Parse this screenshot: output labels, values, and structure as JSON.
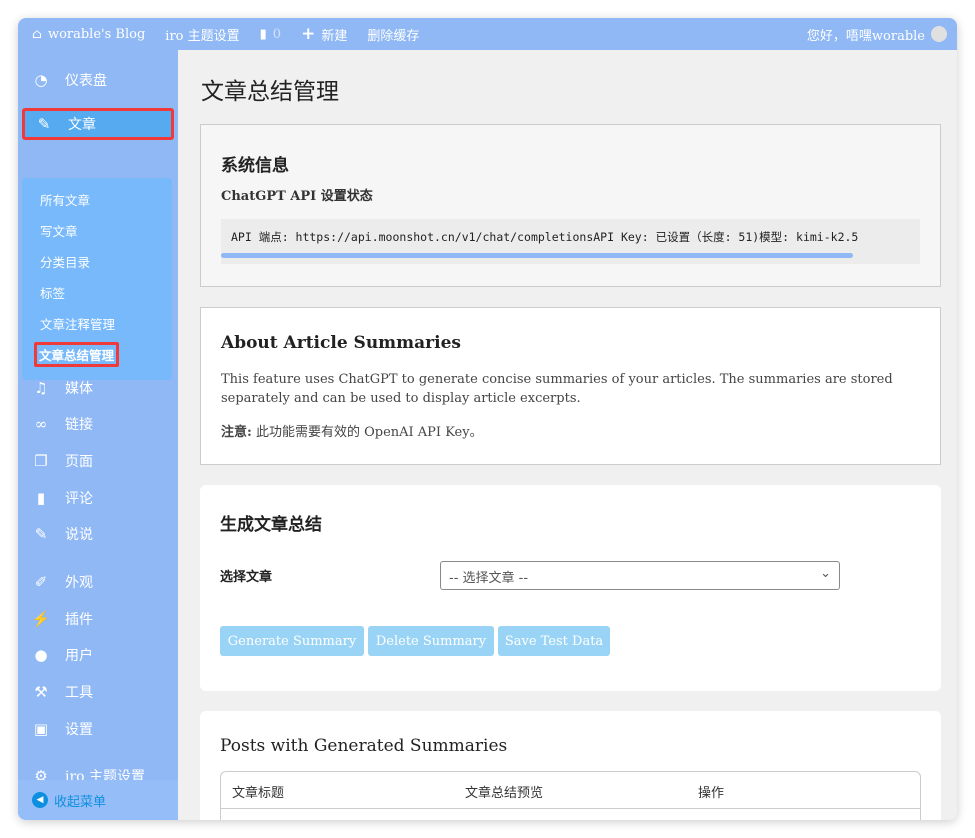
{
  "topbar": {
    "site": "worable's Blog",
    "theme": "iro 主题设置",
    "comments": "0",
    "new": "新建",
    "cache": "删除缓存",
    "greeting": "您好，唔嘿worable"
  },
  "sidebar": {
    "items": [
      {
        "label": "仪表盘",
        "icon": "dashboard-icon"
      },
      {
        "label": "文章",
        "icon": "pin-icon"
      },
      {
        "label": "媒体",
        "icon": "media-icon"
      },
      {
        "label": "链接",
        "icon": "link-icon"
      },
      {
        "label": "页面",
        "icon": "pages-icon"
      },
      {
        "label": "评论",
        "icon": "comment-icon"
      },
      {
        "label": "说说",
        "icon": "pin-icon"
      },
      {
        "label": "外观",
        "icon": "brush-icon"
      },
      {
        "label": "插件",
        "icon": "plugin-icon"
      },
      {
        "label": "用户",
        "icon": "user-icon"
      },
      {
        "label": "工具",
        "icon": "wrench-icon"
      },
      {
        "label": "设置",
        "icon": "settings-icon"
      },
      {
        "label": "iro 主题设置",
        "icon": "gear-icon"
      }
    ],
    "submenu": [
      "所有文章",
      "写文章",
      "分类目录",
      "标签",
      "文章注释管理",
      "文章总结管理"
    ],
    "collapse": "收起菜单"
  },
  "main": {
    "title": "文章总结管理",
    "system": {
      "heading": "系统信息",
      "sub": "ChatGPT API 设置状态",
      "code": "API 端点: https://api.moonshot.cn/v1/chat/completionsAPI Key: 已设置（长度: 51)模型: kimi-k2.5"
    },
    "about": {
      "heading": "About Article Summaries",
      "text": "This feature uses ChatGPT to generate concise summaries of your articles. The summaries are stored separately and can be used to display article excerpts.",
      "note_label": "注意:",
      "note": "此功能需要有效的 OpenAI API Key。"
    },
    "generate": {
      "heading": "生成文章总结",
      "label": "选择文章",
      "select": "-- 选择文章 --",
      "buttons": [
        "Generate Summary",
        "Delete Summary",
        "Save Test Data"
      ]
    },
    "posts": {
      "heading": "Posts with Generated Summaries",
      "columns": [
        "文章标题",
        "文章总结预览",
        "操作"
      ]
    }
  }
}
